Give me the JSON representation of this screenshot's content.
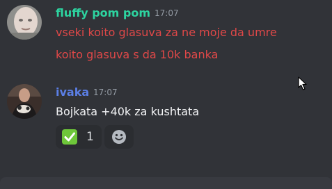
{
  "messages": [
    {
      "author": "fluffy pom pom",
      "author_color": "#2dd4a0",
      "time": "17:07",
      "lines": [
        "vseki koito glasuva za ne moje da umre",
        "koito glasuva s da 10k banka"
      ],
      "text_color": "#e04848"
    },
    {
      "author": "ivaka",
      "author_color": "#5b7fe6",
      "time": "17:07",
      "lines": [
        "Bojkata +40k za kushtata"
      ],
      "text_color": "#f2f3f5",
      "reactions": [
        {
          "icon": "check-mark-icon",
          "count": "1"
        },
        {
          "icon": "add-reaction-icon"
        }
      ]
    }
  ],
  "colors": {
    "background": "#313338",
    "timestamp": "#949ba4",
    "reaction_bg": "#2b2d31"
  }
}
